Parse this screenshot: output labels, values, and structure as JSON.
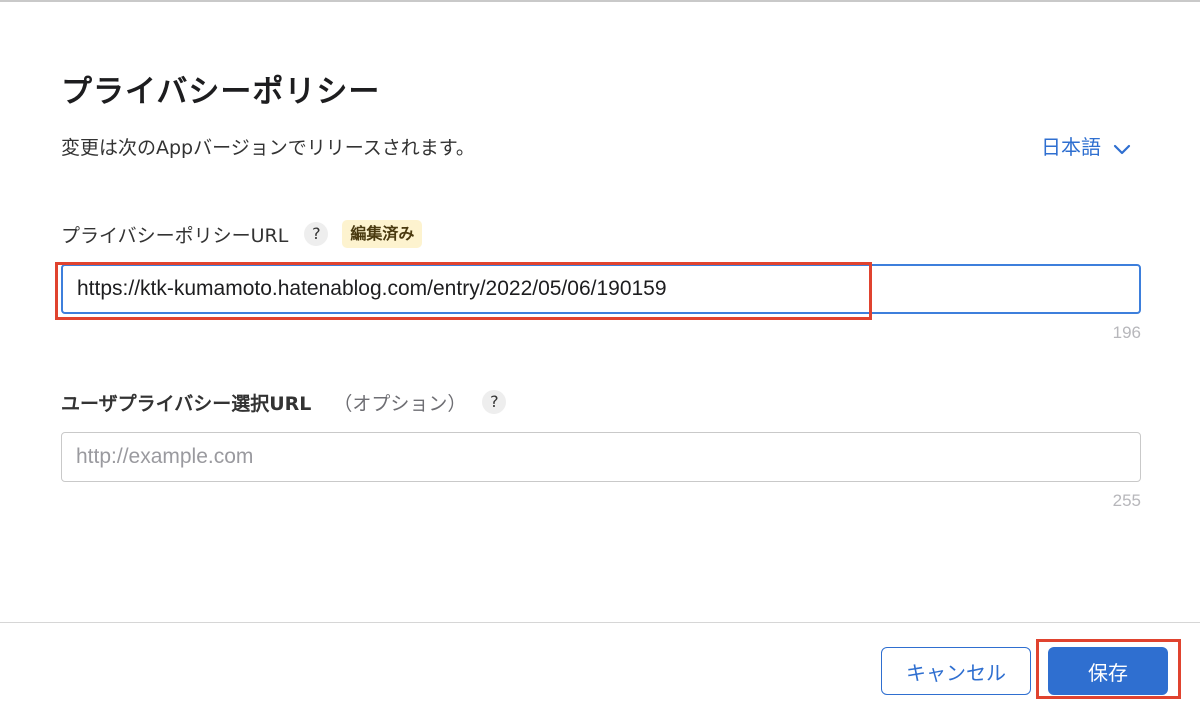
{
  "dialog": {
    "title": "プライバシーポリシー",
    "subtitle": "変更は次のAppバージョンでリリースされます。",
    "language": "日本語"
  },
  "privacy_url": {
    "label": "プライバシーポリシーURL",
    "help": "?",
    "badge": "編集済み",
    "value": "https://ktk-kumamoto.hatenablog.com/entry/2022/05/06/190159",
    "remaining": "196"
  },
  "choices_url": {
    "label": "ユーザプライバシー選択URL",
    "optional": "（オプション）",
    "help": "?",
    "placeholder": "http://example.com",
    "remaining": "255"
  },
  "footer": {
    "cancel_label": "キャンセル",
    "save_label": "保存"
  },
  "colors": {
    "accent": "#2f6fd0",
    "annotation": "#e0432f",
    "badge_bg": "#fdf3cf"
  },
  "icons": {
    "language_dropdown": "chevron-down-icon",
    "help": "question-icon"
  }
}
